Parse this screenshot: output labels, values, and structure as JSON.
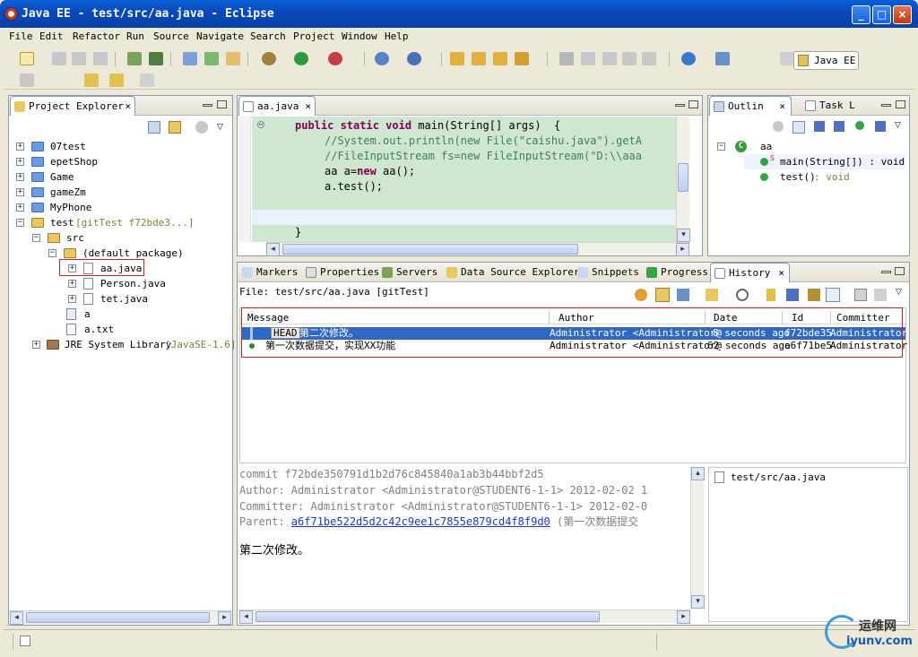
{
  "window": {
    "title": "Java EE - test/src/aa.java - Eclipse",
    "min": "_",
    "max": "□",
    "close": "×"
  },
  "menu": [
    "File",
    "Edit",
    "Refactor",
    "Run",
    "Source",
    "Navigate",
    "Search",
    "Project",
    "Window",
    "Help"
  ],
  "perspective": {
    "label": "Java EE"
  },
  "project_explorer": {
    "tab": "Project Explorer",
    "items": [
      {
        "label": "07test",
        "extra": ""
      },
      {
        "label": "epetShop",
        "extra": ""
      },
      {
        "label": "Game",
        "extra": ""
      },
      {
        "label": "gameZm",
        "extra": ""
      },
      {
        "label": "MyPhone",
        "extra": ""
      },
      {
        "label": "test",
        "extra": " [gitTest f72bde3...]"
      },
      {
        "label": "src",
        "extra": ""
      },
      {
        "label": "(default package)",
        "extra": ""
      },
      {
        "label": "aa.java",
        "extra": ""
      },
      {
        "label": "Person.java",
        "extra": ""
      },
      {
        "label": "tet.java",
        "extra": ""
      },
      {
        "label": "a",
        "extra": ""
      },
      {
        "label": "a.txt",
        "extra": ""
      },
      {
        "label": "JRE System Library",
        "extra": " [JavaSE-1.6]"
      }
    ]
  },
  "editor": {
    "tab": "aa.java",
    "lines": [
      {
        "kw": "public static void ",
        "rest": "main(String[] args)  {"
      },
      {
        "cm": "//System.out.println(new File(\"caishu.java\").getA"
      },
      {
        "cm": "//FileInputStream fs=new FileInputStream(\"D:\\\\aaa"
      },
      {
        "pre": "aa a=",
        "kw": "new",
        "rest": " aa();"
      },
      {
        "pre": "a.test();"
      },
      {
        "pre": ""
      },
      {
        "pre": ""
      },
      {
        "pre": "}"
      }
    ]
  },
  "outline": {
    "tabs": [
      "Outlin",
      "Task L"
    ],
    "class_name": "aa",
    "members": [
      {
        "name": "main(String[]) : void",
        "type": ""
      },
      {
        "name": "test()",
        "type": " : void"
      }
    ],
    "static_marker": "S"
  },
  "bottom_tabs": [
    "Markers",
    "Properties",
    "Servers",
    "Data Source Explorer",
    "Snippets",
    "Progress",
    "History"
  ],
  "history": {
    "file_label": "File: test/src/aa.java [gitTest]",
    "columns": [
      "Message",
      "Author",
      "Date",
      "Id",
      "Committer"
    ],
    "rows": [
      {
        "tag": "HEAD",
        "message": "第二次修改。",
        "author": "Administrator <Administrator@",
        "date": "8 seconds ago",
        "id": "f72bde35",
        "committer": "Administrator"
      },
      {
        "tag": "",
        "message": "第一次数据提交，实现XX功能",
        "author": "Administrator <Administrator@",
        "date": "62 seconds ago",
        "id": "a6f71be5",
        "committer": "Administrator"
      }
    ],
    "details": {
      "commit": "commit f72bde350791d1b2d76c845840a1ab3b44bbf2d5",
      "author": "Author: Administrator <Administrator@STUDENT6-1-1> 2012-02-02 1",
      "committer": "Committer: Administrator <Administrator@STUDENT6-1-1> 2012-02-0",
      "parent_label": "Parent: ",
      "parent_hash": "a6f71be522d5d2c42c9ee1c7855e879cd4f8f9d0",
      "parent_msg": " (第一次数据提交",
      "message": "第二次修改。"
    },
    "files": [
      "test/src/aa.java"
    ]
  },
  "watermark": {
    "cn": "运维网",
    "url": "iyunv.com"
  },
  "colors": {
    "titlebar": "#0848b8",
    "editor_bg": "#cfe6d0",
    "selection": "#3168c6",
    "redbox": "#d02020"
  }
}
